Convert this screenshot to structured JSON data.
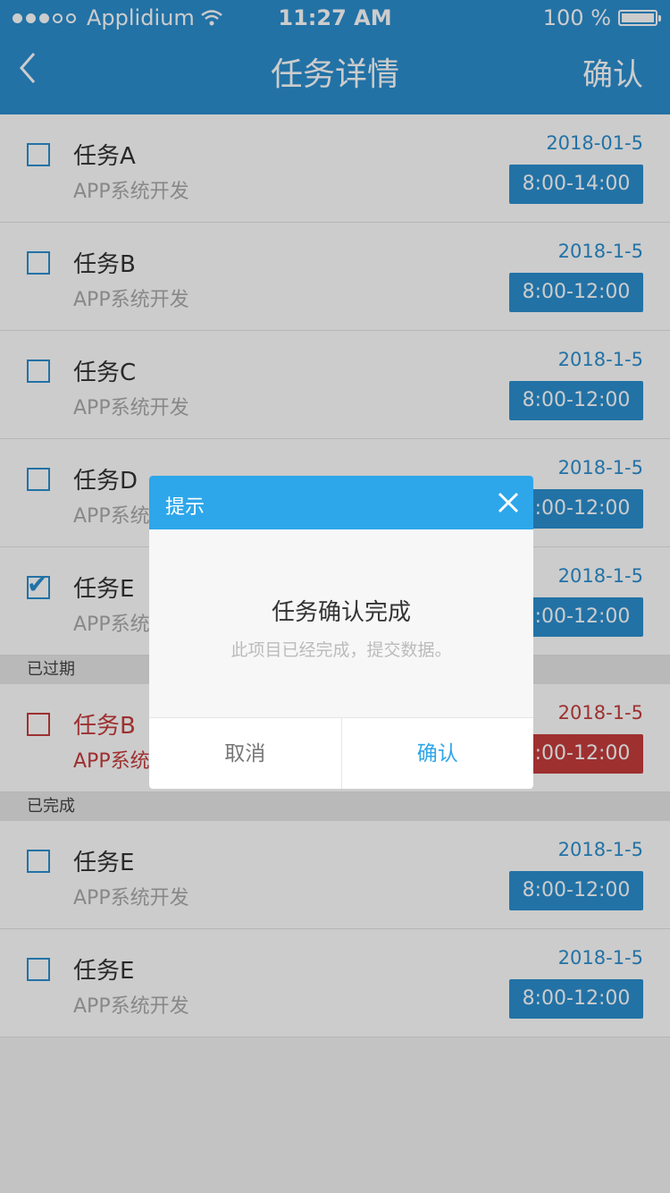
{
  "status_bar": {
    "carrier": "Applidium",
    "time": "11:27 AM",
    "battery": "100 %"
  },
  "nav": {
    "title": "任务详情",
    "confirm": "确认"
  },
  "active_items": [
    {
      "title": "任务A",
      "subtitle": "APP系统开发",
      "date": "2018-01-5",
      "time": "8:00-14:00",
      "checked": false
    },
    {
      "title": "任务B",
      "subtitle": "APP系统开发",
      "date": "2018-1-5",
      "time": "8:00-12:00",
      "checked": false
    },
    {
      "title": "任务C",
      "subtitle": "APP系统开发",
      "date": "2018-1-5",
      "time": "8:00-12:00",
      "checked": false
    },
    {
      "title": "任务D",
      "subtitle": "APP系统开发",
      "date": "2018-1-5",
      "time": "8:00-12:00",
      "checked": false
    },
    {
      "title": "任务E",
      "subtitle": "APP系统开发",
      "date": "2018-1-5",
      "time": "8:00-12:00",
      "checked": true
    }
  ],
  "expired": {
    "header": "已过期",
    "items": [
      {
        "title": "任务B",
        "subtitle": "APP系统开发",
        "date": "2018-1-5",
        "time": "8:00-12:00"
      }
    ]
  },
  "completed": {
    "header": "已完成",
    "items": [
      {
        "title": "任务E",
        "subtitle": "APP系统开发",
        "date": "2018-1-5",
        "time": "8:00-12:00"
      },
      {
        "title": "任务E",
        "subtitle": "APP系统开发",
        "date": "2018-1-5",
        "time": "8:00-12:00"
      }
    ]
  },
  "dialog": {
    "title": "提示",
    "message": "任务确认完成",
    "sub_message": "此项目已经完成，提交数据。",
    "cancel": "取消",
    "ok": "确认"
  },
  "colors": {
    "primary": "#2b8fd0",
    "dialog_accent": "#2ea6ea",
    "expired": "#c63c3c"
  }
}
